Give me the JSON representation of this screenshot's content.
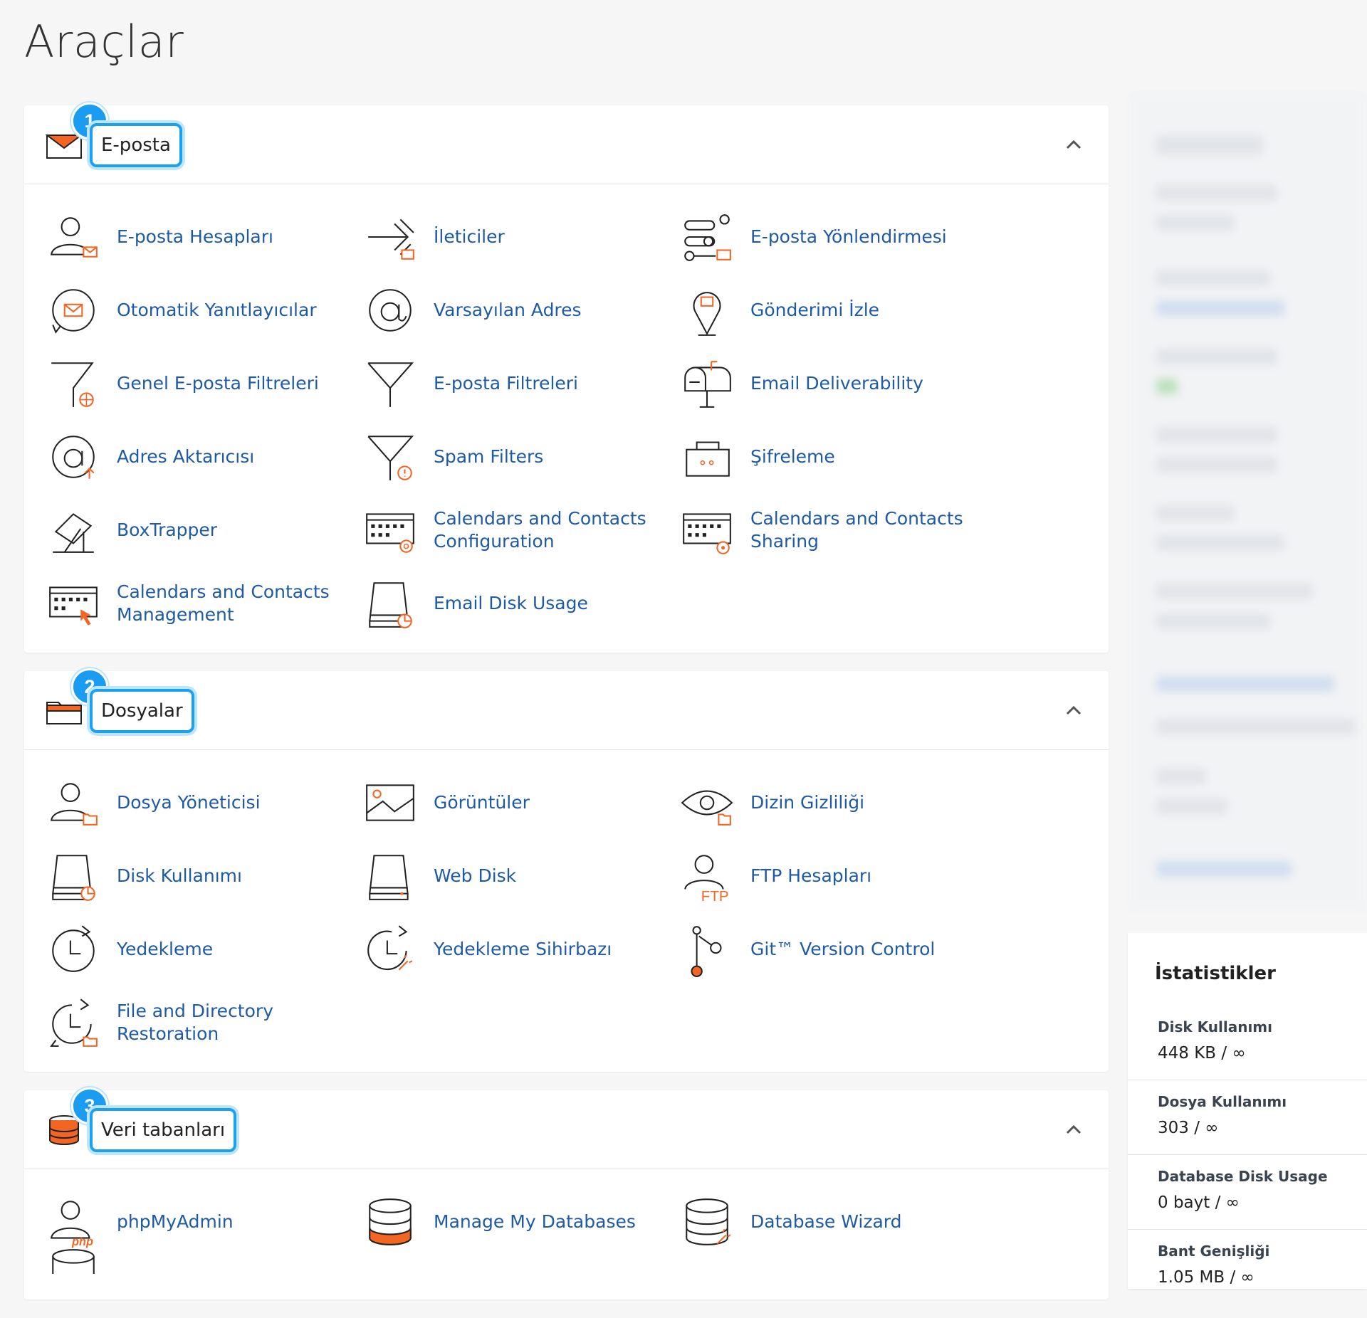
{
  "page": {
    "title": "Araçlar"
  },
  "sections": [
    {
      "title": "E-posta",
      "badge": "1",
      "items": [
        {
          "label": "E-posta Hesapları",
          "icon": "user-mail-icon"
        },
        {
          "label": "İleticiler",
          "icon": "forwarder-icon"
        },
        {
          "label": "E-posta Yönlendirmesi",
          "icon": "routing-icon"
        },
        {
          "label": "Otomatik Yanıtlayıcılar",
          "icon": "autoresponder-icon"
        },
        {
          "label": "Varsayılan Adres",
          "icon": "at-sign-icon"
        },
        {
          "label": "Gönderimi İzle",
          "icon": "track-delivery-icon"
        },
        {
          "label": "Genel E-posta Filtreleri",
          "icon": "global-filter-icon"
        },
        {
          "label": "E-posta Filtreleri",
          "icon": "filter-icon"
        },
        {
          "label": "Email Deliverability",
          "icon": "mailbox-icon"
        },
        {
          "label": "Adres Aktarıcısı",
          "icon": "address-importer-icon"
        },
        {
          "label": "Spam Filters",
          "icon": "spam-filter-icon"
        },
        {
          "label": "Şifreleme",
          "icon": "encryption-icon"
        },
        {
          "label": "BoxTrapper",
          "icon": "boxtrapper-icon"
        },
        {
          "label": "Calendars and Contacts Configuration",
          "icon": "calendar-config-icon"
        },
        {
          "label": "Calendars and Contacts Sharing",
          "icon": "calendar-sharing-icon"
        },
        {
          "label": "Calendars and Contacts Management",
          "icon": "calendar-management-icon"
        },
        {
          "label": "Email Disk Usage",
          "icon": "email-disk-usage-icon"
        }
      ]
    },
    {
      "title": "Dosyalar",
      "badge": "2",
      "items": [
        {
          "label": "Dosya Yöneticisi",
          "icon": "file-manager-icon"
        },
        {
          "label": "Görüntüler",
          "icon": "images-icon"
        },
        {
          "label": "Dizin Gizliliği",
          "icon": "directory-privacy-icon"
        },
        {
          "label": "Disk Kullanımı",
          "icon": "disk-usage-icon"
        },
        {
          "label": "Web Disk",
          "icon": "web-disk-icon"
        },
        {
          "label": "FTP Hesapları",
          "icon": "ftp-accounts-icon"
        },
        {
          "label": "Yedekleme",
          "icon": "backup-icon"
        },
        {
          "label": "Yedekleme Sihirbazı",
          "icon": "backup-wizard-icon"
        },
        {
          "label": "Git™ Version Control",
          "icon": "git-icon"
        },
        {
          "label": "File and Directory Restoration",
          "icon": "restore-icon"
        }
      ]
    },
    {
      "title": "Veri tabanları",
      "badge": "3",
      "items": [
        {
          "label": "phpMyAdmin",
          "icon": "phpmyadmin-icon"
        },
        {
          "label": "Manage My Databases",
          "icon": "database-icon"
        },
        {
          "label": "Database Wizard",
          "icon": "database-wizard-icon"
        },
        {
          "label": "",
          "icon": "database-partial-icon"
        }
      ]
    }
  ],
  "stats": {
    "title": "İstatistikler",
    "rows": [
      {
        "label": "Disk Kullanımı",
        "value": "448 KB / ∞"
      },
      {
        "label": "Dosya Kullanımı",
        "value": "303 / ∞"
      },
      {
        "label": "Database Disk Usage",
        "value": "0 bayt / ∞"
      },
      {
        "label": "Bant Genişliği",
        "value": "1.05 MB / ∞"
      }
    ]
  },
  "colors": {
    "accent": "#1a9cf0",
    "link": "#1f5aa6",
    "orange": "#f26522"
  }
}
